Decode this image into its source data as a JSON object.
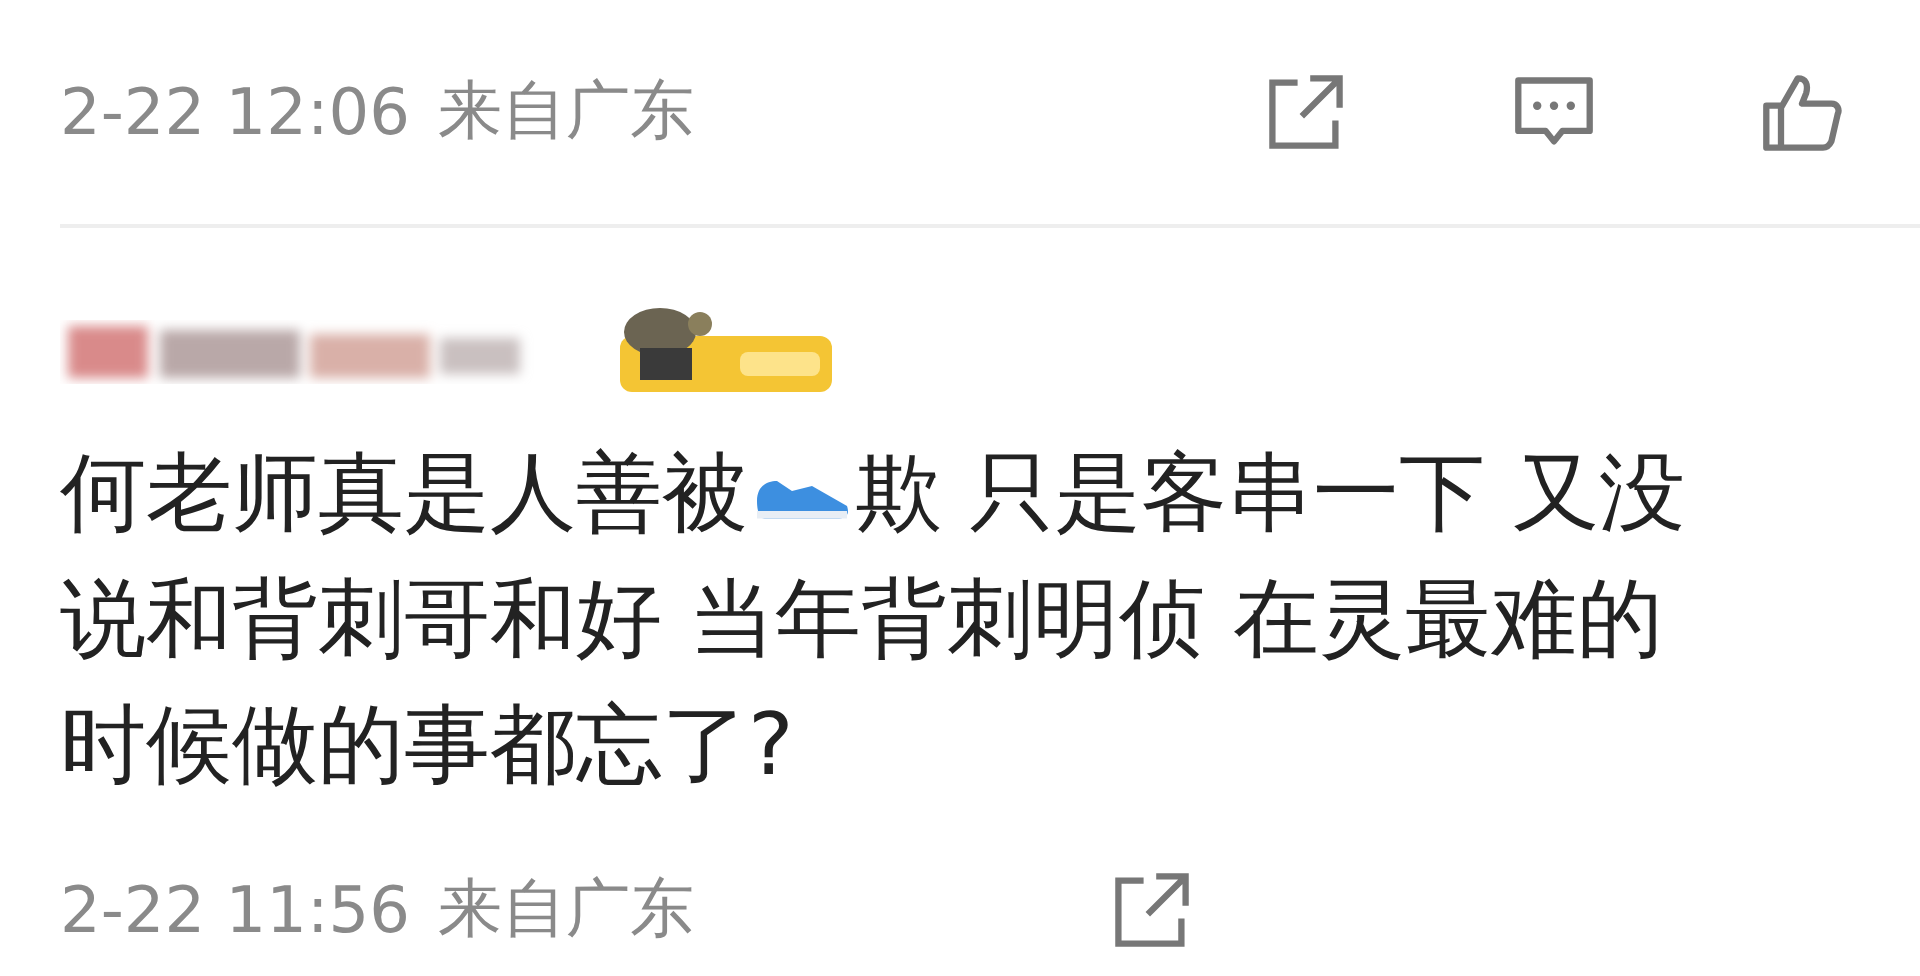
{
  "top_meta": {
    "time": "2-22 12:06",
    "location": "来自广东",
    "actions": [
      {
        "kind": "share"
      },
      {
        "kind": "comment"
      },
      {
        "kind": "like"
      }
    ]
  },
  "comment": {
    "text_before": "何老师真是人善被",
    "text_after": "欺 只是客串一下 又没",
    "more_lines": [
      "说和背刺哥和好 当年背刺明侦 在灵最难的",
      "时候做的事都忘了?"
    ]
  },
  "bottom_meta": {
    "time": "2-22 11:56",
    "location": "来自广东",
    "actions": [
      {
        "kind": "share"
      }
    ]
  }
}
